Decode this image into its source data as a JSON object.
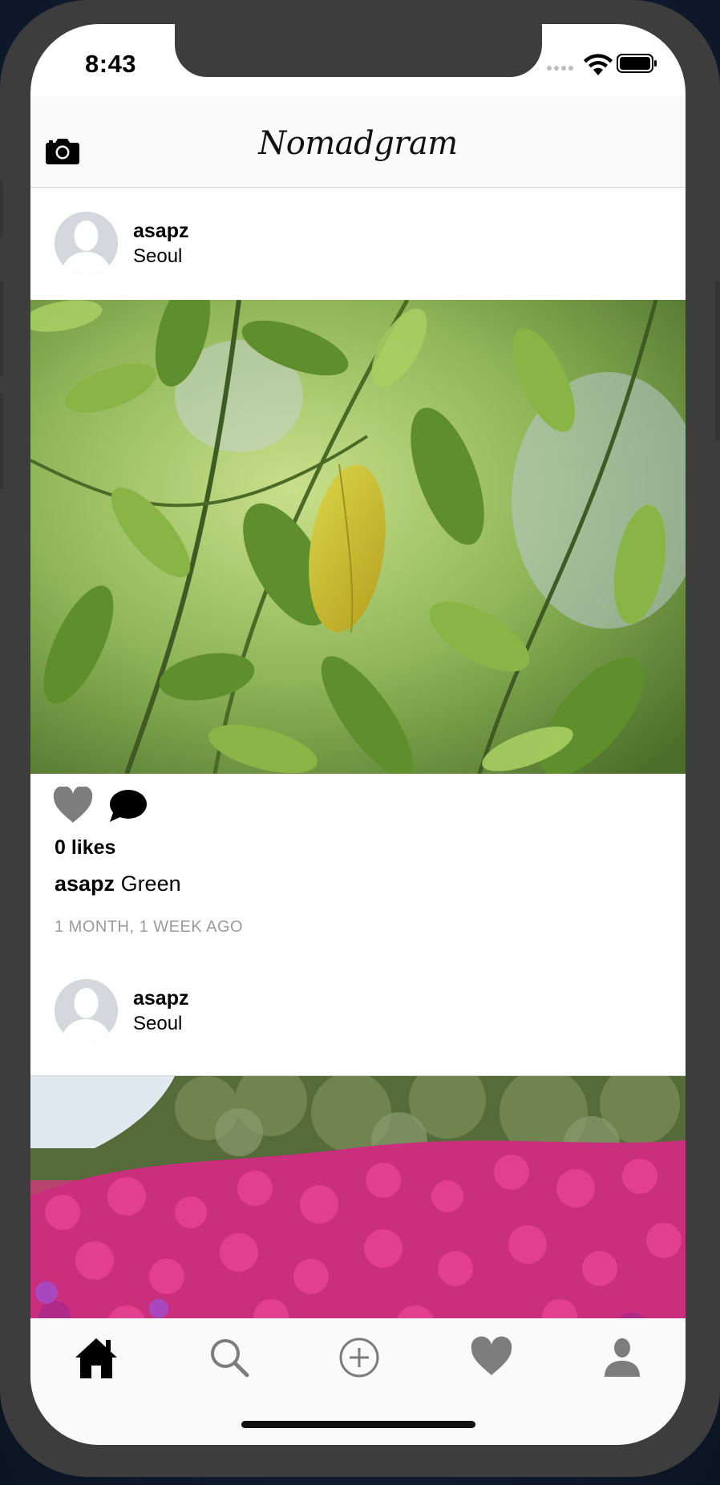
{
  "status_bar": {
    "time": "8:43"
  },
  "header": {
    "brand": "Nomadgram"
  },
  "posts": [
    {
      "username": "asapz",
      "location": "Seoul",
      "likes": "0 likes",
      "caption_user": "asapz",
      "caption_text": "Green",
      "timestamp": "1 MONTH, 1 WEEK AGO"
    },
    {
      "username": "asapz",
      "location": "Seoul"
    }
  ],
  "tabs": [
    {
      "icon": "home-icon",
      "active": true
    },
    {
      "icon": "search-icon",
      "active": false
    },
    {
      "icon": "add-icon",
      "active": false
    },
    {
      "icon": "heart-icon",
      "active": false
    },
    {
      "icon": "profile-icon",
      "active": false
    }
  ],
  "colors": {
    "icon_gray": "#7d7d7d",
    "active_icon": "#000000",
    "timestamp_gray": "#9b9b9b",
    "frame": "#3d3d3d"
  }
}
